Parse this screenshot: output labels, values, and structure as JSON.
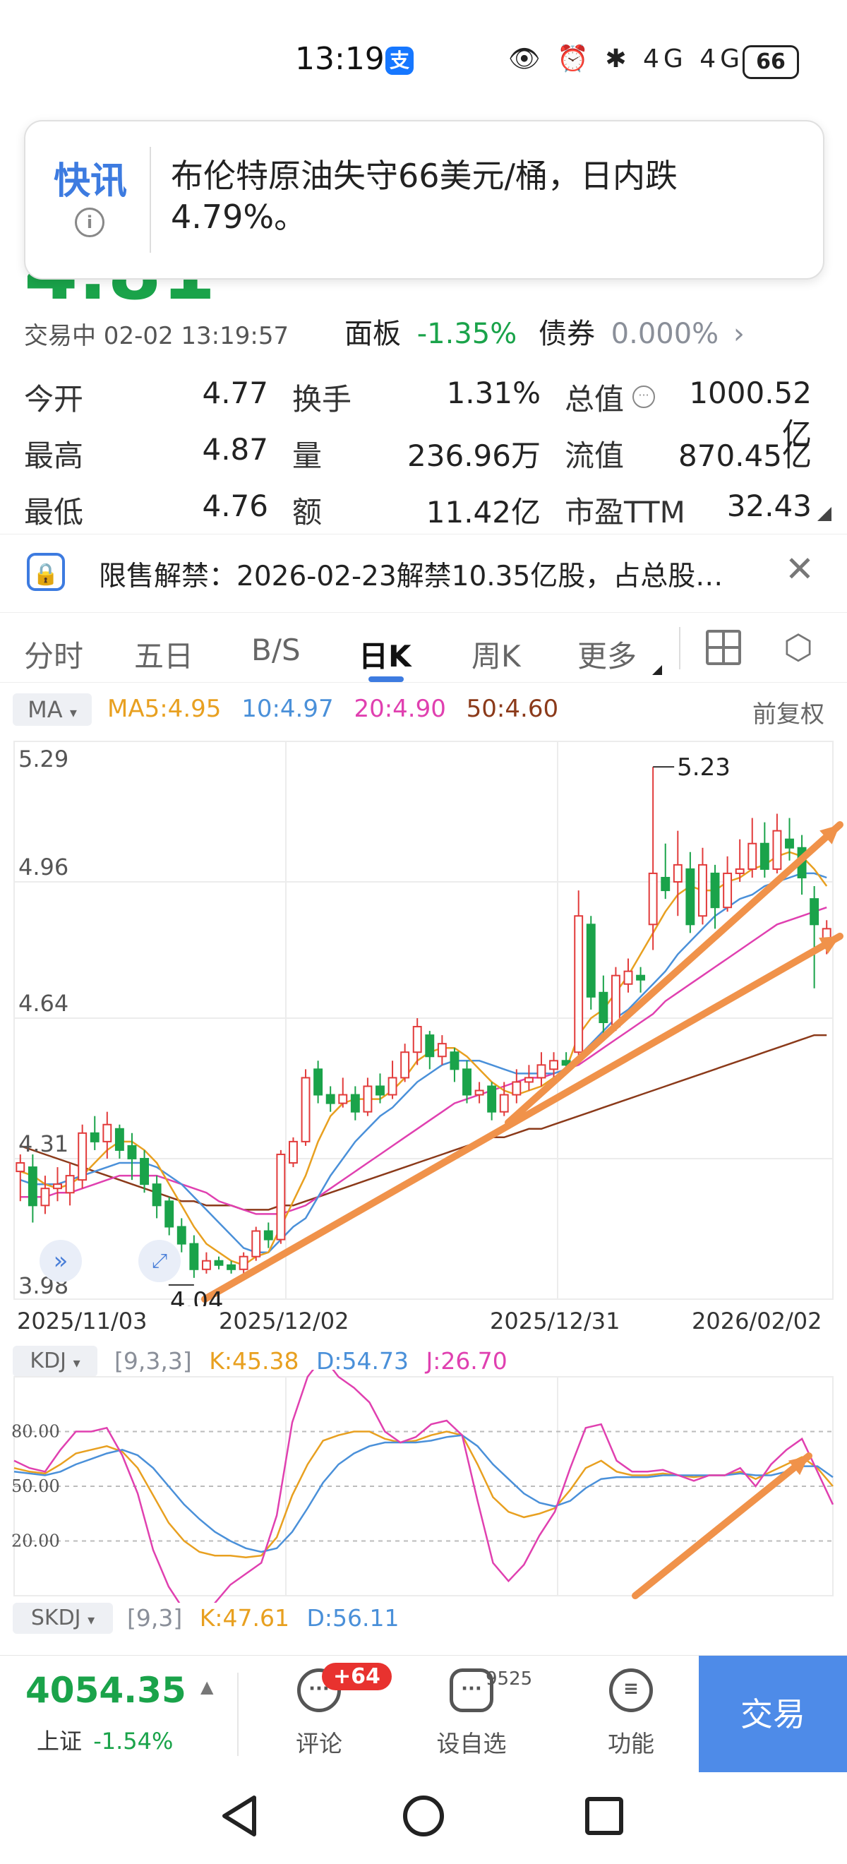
{
  "status_bar": {
    "time": "13:19",
    "pay_icon": "支",
    "battery": "66",
    "icons": "👁 ⏰ ✱ 4G 4G"
  },
  "toast": {
    "label": "快讯",
    "text": "布伦特原油失守66美元/桶，日内跌4.79%。"
  },
  "quote": {
    "price": "4.81",
    "trade_status": "交易中 02-02 13:19:57",
    "panel_label": "面板",
    "panel_value": "-1.35%",
    "bond_label": "债券",
    "bond_value": "0.000%"
  },
  "stats": {
    "open_label": "今开",
    "open": "4.77",
    "turnover_label": "换手",
    "turnover": "1.31%",
    "mktcap_label": "总值",
    "mktcap": "1000.52亿",
    "high_label": "最高",
    "high": "4.87",
    "volume_label": "量",
    "volume": "236.96万",
    "float_label": "流值",
    "float": "870.45亿",
    "low_label": "最低",
    "low": "4.76",
    "amount_label": "额",
    "amount": "11.42亿",
    "pe_label": "市盈TTM",
    "pe": "32.43"
  },
  "notice": {
    "text": "限售解禁：2026-02-23解禁10.35亿股，占总股…"
  },
  "tabs": [
    "分时",
    "五日",
    "B/S",
    "日K",
    "周K",
    "更多"
  ],
  "chart_header": {
    "ma_selector": "MA",
    "ma5": "MA5:4.95",
    "ma10": "10:4.97",
    "ma20": "20:4.90",
    "ma50": "50:4.60",
    "adjust": "前复权"
  },
  "colors": {
    "ma5": "#e8a020",
    "ma10": "#4a90d9",
    "ma20": "#e040b0",
    "ma50": "#8b3a1a",
    "up": "#e23b3b",
    "down": "#1aa34a",
    "arrow": "#f0924a"
  },
  "chart_data": [
    {
      "type": "candlestick",
      "y_ticks": [
        "5.29",
        "4.96",
        "4.64",
        "4.31",
        "3.98"
      ],
      "ylim": [
        3.98,
        5.29
      ],
      "x_labels": [
        "2025/11/03",
        "2025/12/02",
        "2025/12/31",
        "2026/02/02"
      ],
      "annotations": {
        "max": "5.23",
        "min": "4.04"
      },
      "series_values": {
        "candles": [
          [
            4.28,
            4.3,
            4.21,
            4.32
          ],
          [
            4.29,
            4.2,
            4.16,
            4.32
          ],
          [
            4.2,
            4.24,
            4.18,
            4.27
          ],
          [
            4.24,
            4.25,
            4.21,
            4.29
          ],
          [
            4.23,
            4.27,
            4.2,
            4.3
          ],
          [
            4.26,
            4.37,
            4.24,
            4.39
          ],
          [
            4.37,
            4.35,
            4.33,
            4.41
          ],
          [
            4.35,
            4.39,
            4.31,
            4.42
          ],
          [
            4.38,
            4.33,
            4.31,
            4.39
          ],
          [
            4.34,
            4.31,
            4.26,
            4.37
          ],
          [
            4.31,
            4.25,
            4.23,
            4.33
          ],
          [
            4.25,
            4.2,
            4.17,
            4.27
          ],
          [
            4.21,
            4.15,
            4.13,
            4.22
          ],
          [
            4.15,
            4.11,
            4.09,
            4.17
          ],
          [
            4.11,
            4.05,
            4.03,
            4.13
          ],
          [
            4.05,
            4.07,
            4.04,
            4.09
          ],
          [
            4.07,
            4.06,
            4.05,
            4.08
          ],
          [
            4.06,
            4.05,
            4.04,
            4.07
          ],
          [
            4.05,
            4.08,
            4.04,
            4.09
          ],
          [
            4.08,
            4.14,
            4.07,
            4.15
          ],
          [
            4.14,
            4.12,
            4.1,
            4.16
          ],
          [
            4.12,
            4.32,
            4.11,
            4.33
          ],
          [
            4.3,
            4.35,
            4.29,
            4.36
          ],
          [
            4.35,
            4.5,
            4.34,
            4.52
          ],
          [
            4.52,
            4.46,
            4.44,
            4.54
          ],
          [
            4.46,
            4.44,
            4.42,
            4.48
          ],
          [
            4.44,
            4.46,
            4.43,
            4.5
          ],
          [
            4.46,
            4.42,
            4.4,
            4.48
          ],
          [
            4.42,
            4.48,
            4.41,
            4.5
          ],
          [
            4.48,
            4.46,
            4.44,
            4.51
          ],
          [
            4.46,
            4.5,
            4.45,
            4.54
          ],
          [
            4.5,
            4.56,
            4.49,
            4.58
          ],
          [
            4.56,
            4.62,
            4.53,
            4.64
          ],
          [
            4.6,
            4.55,
            4.52,
            4.61
          ],
          [
            4.55,
            4.58,
            4.53,
            4.6
          ],
          [
            4.56,
            4.52,
            4.49,
            4.57
          ],
          [
            4.52,
            4.46,
            4.44,
            4.54
          ],
          [
            4.46,
            4.47,
            4.44,
            4.49
          ],
          [
            4.48,
            4.42,
            4.4,
            4.49
          ],
          [
            4.42,
            4.46,
            4.41,
            4.49
          ],
          [
            4.46,
            4.49,
            4.44,
            4.52
          ],
          [
            4.49,
            4.5,
            4.47,
            4.53
          ],
          [
            4.5,
            4.53,
            4.48,
            4.56
          ],
          [
            4.52,
            4.54,
            4.5,
            4.56
          ],
          [
            4.54,
            4.53,
            4.51,
            4.56
          ],
          [
            4.56,
            4.88,
            4.55,
            4.94
          ],
          [
            4.86,
            4.69,
            4.66,
            4.88
          ],
          [
            4.7,
            4.63,
            4.6,
            4.74
          ],
          [
            4.62,
            4.74,
            4.61,
            4.76
          ],
          [
            4.72,
            4.75,
            4.7,
            4.78
          ],
          [
            4.74,
            4.73,
            4.7,
            4.76
          ],
          [
            4.86,
            4.98,
            4.8,
            5.23
          ],
          [
            4.97,
            4.94,
            4.92,
            5.05
          ],
          [
            4.96,
            5.0,
            4.88,
            5.08
          ],
          [
            4.99,
            4.86,
            4.84,
            5.03
          ],
          [
            4.88,
            5.0,
            4.86,
            5.04
          ],
          [
            4.98,
            4.9,
            4.85,
            5.0
          ],
          [
            4.9,
            4.98,
            4.89,
            5.02
          ],
          [
            4.98,
            4.99,
            4.96,
            5.06
          ],
          [
            4.99,
            5.05,
            4.97,
            5.11
          ],
          [
            5.05,
            4.99,
            4.97,
            5.1
          ],
          [
            4.99,
            5.08,
            4.98,
            5.12
          ],
          [
            5.06,
            5.04,
            5.01,
            5.11
          ],
          [
            5.04,
            4.97,
            4.93,
            5.07
          ],
          [
            4.92,
            4.86,
            4.71,
            4.95
          ],
          [
            4.82,
            4.85,
            4.79,
            4.87
          ]
        ],
        "ma5": [
          4.28,
          4.27,
          4.25,
          4.24,
          4.25,
          4.27,
          4.3,
          4.33,
          4.35,
          4.35,
          4.33,
          4.3,
          4.25,
          4.2,
          4.15,
          4.11,
          4.09,
          4.07,
          4.06,
          4.08,
          4.09,
          4.15,
          4.21,
          4.27,
          4.35,
          4.41,
          4.44,
          4.45,
          4.45,
          4.45,
          4.47,
          4.5,
          4.54,
          4.56,
          4.57,
          4.57,
          4.55,
          4.52,
          4.49,
          4.47,
          4.46,
          4.47,
          4.48,
          4.5,
          4.52,
          4.6,
          4.64,
          4.66,
          4.7,
          4.74,
          4.79,
          4.84,
          4.89,
          4.93,
          4.95,
          4.94,
          4.94,
          4.96,
          4.97,
          4.99,
          5.0,
          5.02,
          5.03,
          5.02,
          4.99,
          4.95
        ],
        "ma10": [
          4.26,
          4.25,
          4.25,
          4.25,
          4.26,
          4.27,
          4.28,
          4.29,
          4.3,
          4.3,
          4.3,
          4.29,
          4.27,
          4.25,
          4.22,
          4.19,
          4.16,
          4.13,
          4.1,
          4.09,
          4.09,
          4.12,
          4.15,
          4.17,
          4.22,
          4.27,
          4.31,
          4.35,
          4.38,
          4.41,
          4.43,
          4.46,
          4.49,
          4.51,
          4.53,
          4.54,
          4.54,
          4.54,
          4.53,
          4.52,
          4.51,
          4.51,
          4.51,
          4.51,
          4.52,
          4.55,
          4.58,
          4.61,
          4.64,
          4.66,
          4.69,
          4.72,
          4.75,
          4.79,
          4.82,
          4.85,
          4.88,
          4.9,
          4.92,
          4.93,
          4.95,
          4.96,
          4.97,
          4.98,
          4.98,
          4.97
        ],
        "ma20": [
          4.22,
          4.22,
          4.22,
          4.23,
          4.23,
          4.24,
          4.25,
          4.26,
          4.27,
          4.27,
          4.27,
          4.27,
          4.26,
          4.25,
          4.24,
          4.23,
          4.21,
          4.2,
          4.19,
          4.18,
          4.18,
          4.18,
          4.19,
          4.2,
          4.22,
          4.24,
          4.26,
          4.28,
          4.3,
          4.32,
          4.34,
          4.36,
          4.38,
          4.4,
          4.42,
          4.44,
          4.45,
          4.46,
          4.47,
          4.48,
          4.49,
          4.5,
          4.5,
          4.51,
          4.52,
          4.53,
          4.55,
          4.57,
          4.59,
          4.61,
          4.63,
          4.65,
          4.68,
          4.7,
          4.72,
          4.74,
          4.76,
          4.78,
          4.8,
          4.82,
          4.84,
          4.86,
          4.87,
          4.88,
          4.89,
          4.9
        ],
        "ma50": [
          4.34,
          4.33,
          4.32,
          4.31,
          4.3,
          4.29,
          4.28,
          4.27,
          4.26,
          4.25,
          4.24,
          4.23,
          4.22,
          4.21,
          4.21,
          4.2,
          4.2,
          4.2,
          4.19,
          4.19,
          4.19,
          4.2,
          4.2,
          4.21,
          4.22,
          4.23,
          4.24,
          4.25,
          4.26,
          4.27,
          4.28,
          4.29,
          4.3,
          4.31,
          4.32,
          4.33,
          4.34,
          4.35,
          4.36,
          4.36,
          4.37,
          4.38,
          4.38,
          4.39,
          4.4,
          4.41,
          4.42,
          4.43,
          4.44,
          4.45,
          4.46,
          4.47,
          4.48,
          4.49,
          4.5,
          4.51,
          4.52,
          4.53,
          4.54,
          4.55,
          4.56,
          4.57,
          4.58,
          4.59,
          4.6,
          4.6
        ]
      }
    },
    {
      "type": "line",
      "title": "KDJ",
      "params": "[9,3,3]",
      "legend": {
        "k": "K:45.38",
        "d": "D:54.73",
        "j": "J:26.70"
      },
      "y_ticks": [
        "80.00",
        "50.00",
        "20.00"
      ],
      "ylim": [
        -10,
        110
      ],
      "series": [
        {
          "name": "K",
          "values": [
            60,
            58,
            57,
            62,
            68,
            70,
            72,
            69,
            60,
            45,
            30,
            20,
            14,
            12,
            12,
            11,
            12,
            22,
            45,
            62,
            75,
            78,
            80,
            80,
            76,
            74,
            75,
            78,
            80,
            78,
            62,
            44,
            36,
            33,
            35,
            38,
            48,
            60,
            64,
            58,
            56,
            56,
            57,
            56,
            55,
            56,
            56,
            58,
            54,
            58,
            62,
            66,
            60,
            50
          ]
        },
        {
          "name": "D",
          "values": [
            58,
            57,
            56,
            58,
            62,
            65,
            68,
            70,
            67,
            60,
            50,
            40,
            32,
            25,
            20,
            16,
            14,
            16,
            25,
            38,
            52,
            62,
            68,
            72,
            74,
            74,
            74,
            75,
            77,
            78,
            72,
            62,
            54,
            46,
            41,
            39,
            42,
            49,
            54,
            55,
            55,
            55,
            56,
            56,
            56,
            56,
            56,
            57,
            56,
            56,
            58,
            61,
            61,
            55
          ]
        },
        {
          "name": "J",
          "values": [
            64,
            60,
            58,
            70,
            80,
            80,
            82,
            67,
            46,
            15,
            -5,
            -18,
            -22,
            -14,
            -4,
            2,
            8,
            34,
            85,
            110,
            121,
            110,
            104,
            96,
            80,
            74,
            77,
            84,
            86,
            78,
            42,
            8,
            -2,
            7,
            23,
            36,
            60,
            82,
            84,
            64,
            58,
            58,
            59,
            56,
            53,
            56,
            56,
            60,
            50,
            62,
            70,
            76,
            58,
            40
          ]
        }
      ]
    }
  ],
  "kdj_label": "KDJ",
  "skdj": {
    "label": "SKDJ",
    "params": "[9,3]",
    "k": "K:47.61",
    "d": "D:56.11"
  },
  "bottom_bar": {
    "index_price": "4054.35",
    "index_name": "上证",
    "index_change": "-1.54%",
    "comment_label": "评论",
    "comment_badge": "+64",
    "watch_label": "设自选",
    "watch_count": "9525",
    "func_label": "功能",
    "trade_label": "交易"
  }
}
